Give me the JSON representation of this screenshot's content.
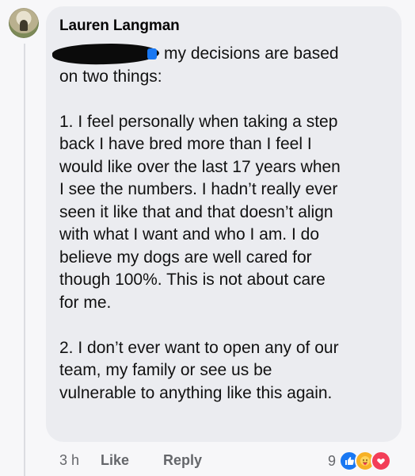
{
  "comment": {
    "author": "Lauren Langman",
    "lines": [
      "my decisions are based",
      "on two things:",
      "",
      "1. I feel personally when taking a step",
      "back I have bred more than I feel I",
      "would like over the last 17 years when",
      "I see the numbers. I hadn’t really ever",
      "seen it like that and that doesn’t align",
      "with what I want and who I am. I do",
      "believe my dogs are well cared for",
      "though 100%. This is not about care",
      "for me.",
      "",
      "2. I don’t ever want to open any of our",
      "team, my family or see us be",
      "vulnerable to anything like this again."
    ],
    "redacted_mention": true
  },
  "actions": {
    "time": "3 h",
    "like_label": "Like",
    "reply_label": "Reply"
  },
  "reactions": {
    "count": "9",
    "icons": [
      "like-icon",
      "care-icon",
      "love-icon"
    ],
    "colors": {
      "like": "#1877f2",
      "care": "#f7b125",
      "love": "#f33e58"
    }
  },
  "colors": {
    "bubble": "#ebecf0",
    "background": "#f7f7f9",
    "secondary_text": "#65676b"
  }
}
